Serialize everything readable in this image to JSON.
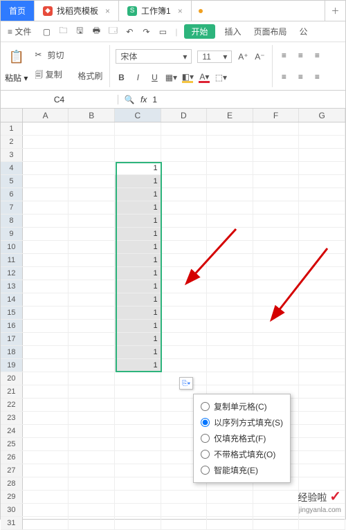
{
  "tabs": {
    "home": "首页",
    "template": "找稻壳模板",
    "workbook": "工作簿1"
  },
  "menubar": {
    "file": "文件",
    "start": "开始",
    "insert": "插入",
    "layout": "页面布局",
    "last": "公"
  },
  "ribbon": {
    "cut": "剪切",
    "copy": "复制",
    "paste": "粘贴",
    "fmtpainter": "格式刷",
    "font": "宋体",
    "size": "11",
    "bold": "B",
    "italic": "I",
    "underline": "U"
  },
  "namebox": "C4",
  "formula": "1",
  "fx": "fx",
  "columns": [
    "A",
    "B",
    "C",
    "D",
    "E",
    "F",
    "G"
  ],
  "rows": [
    "1",
    "2",
    "3",
    "4",
    "5",
    "6",
    "7",
    "8",
    "9",
    "10",
    "11",
    "12",
    "13",
    "14",
    "15",
    "16",
    "17",
    "18",
    "19",
    "20",
    "21",
    "22",
    "23",
    "24",
    "25",
    "26",
    "27",
    "28",
    "29",
    "30",
    "31"
  ],
  "fillvalue": "1",
  "autofill": {
    "copy": "复制单元格(C)",
    "series": "以序列方式填充(S)",
    "fmt": "仅填充格式(F)",
    "nofmt": "不带格式填充(O)",
    "smart": "智能填充(E)"
  },
  "watermark": {
    "brand": "经验啦",
    "url": "jingyanla.com"
  }
}
